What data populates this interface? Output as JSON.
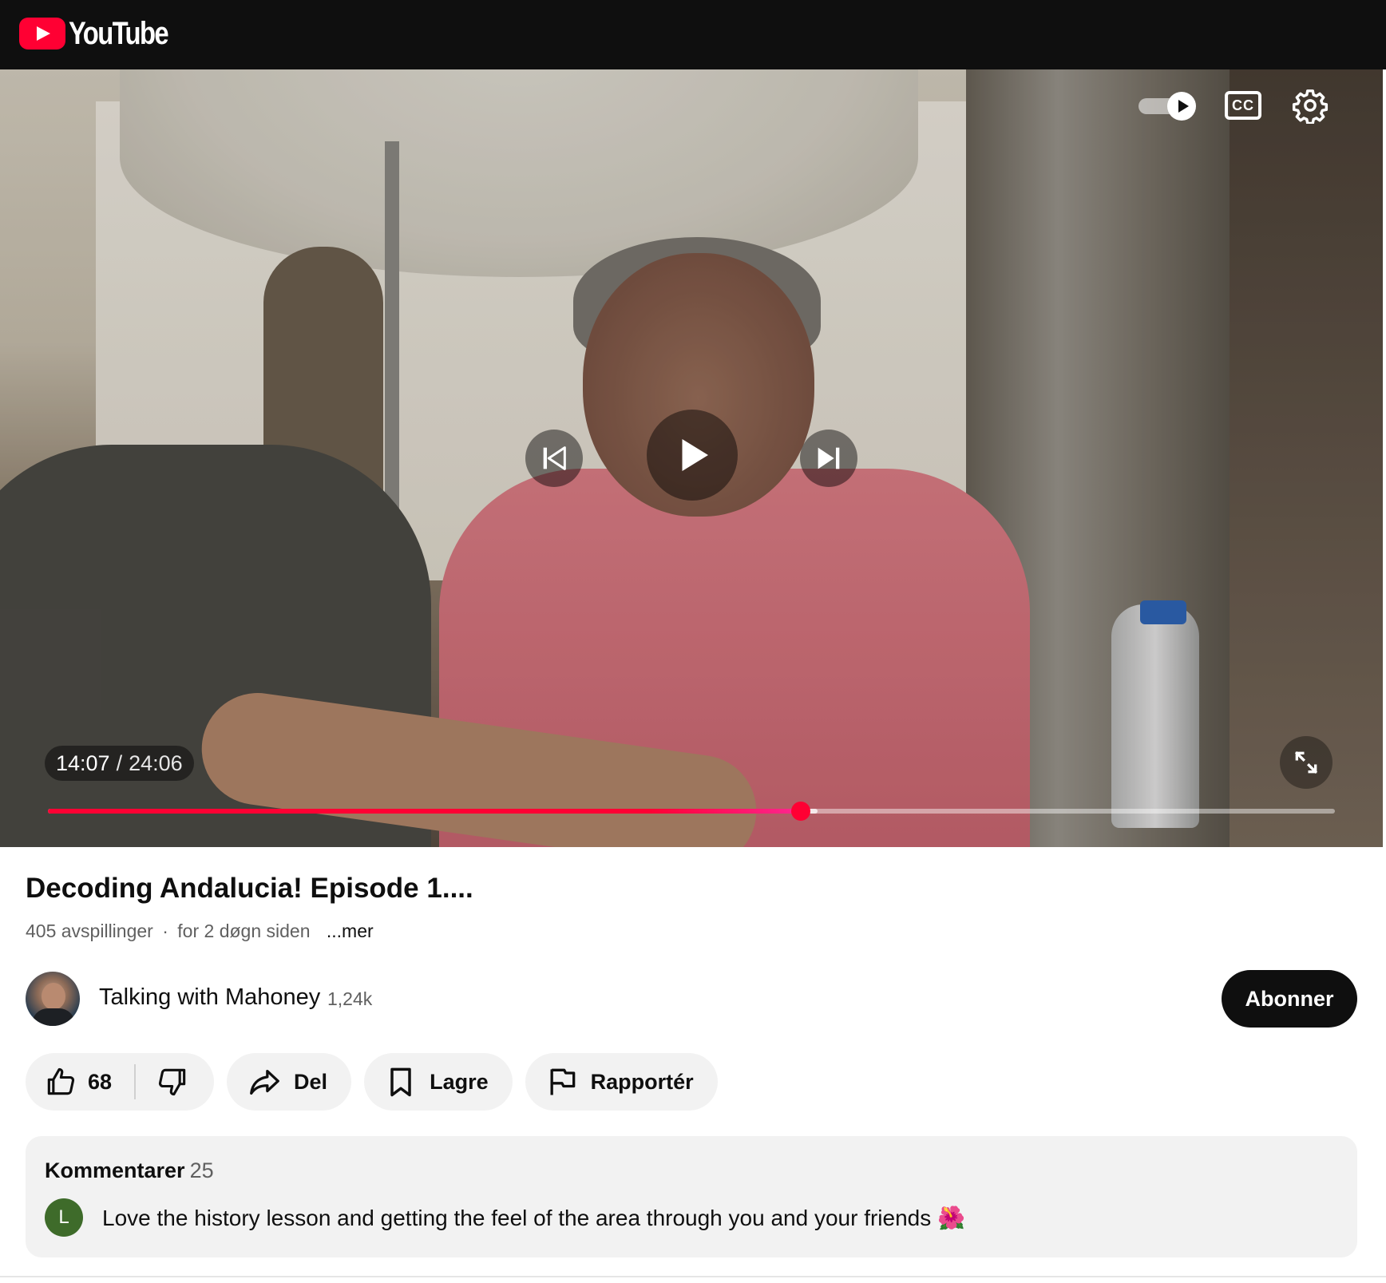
{
  "header": {
    "logo_text": "YouTube"
  },
  "player": {
    "current_time": "14:07",
    "separator": "/",
    "duration": "24:06",
    "progress_fraction": 0.585,
    "buffered_fraction": 0.598,
    "cc_label": "CC",
    "accent_color": "#ff0033"
  },
  "video": {
    "title": "Decoding Andalucia! Episode 1....",
    "views": "405 avspillinger",
    "age": "for 2 døgn siden",
    "meta_separator": "·",
    "more_label": "...mer"
  },
  "channel": {
    "name": "Talking with Mahoney",
    "subscribers": "1,24k",
    "subscribe_label": "Abonner"
  },
  "actions": {
    "like_count": "68",
    "share_label": "Del",
    "save_label": "Lagre",
    "report_label": "Rapportér"
  },
  "comments": {
    "header": "Kommentarer",
    "count": "25",
    "top_comment": {
      "avatar_initial": "L",
      "text": "Love the history lesson and getting the feel of the area through you and your friends 🌺"
    }
  },
  "icons": {
    "logo": "youtube-logo-icon",
    "autoplay": "autoplay-toggle-icon",
    "captions": "closed-captions-icon",
    "settings": "gear-icon",
    "previous": "skip-previous-icon",
    "play": "play-icon",
    "next": "skip-next-icon",
    "fullscreen": "fullscreen-icon",
    "like": "thumbs-up-icon",
    "dislike": "thumbs-down-icon",
    "share": "share-icon",
    "save": "bookmark-icon",
    "report": "flag-icon"
  }
}
